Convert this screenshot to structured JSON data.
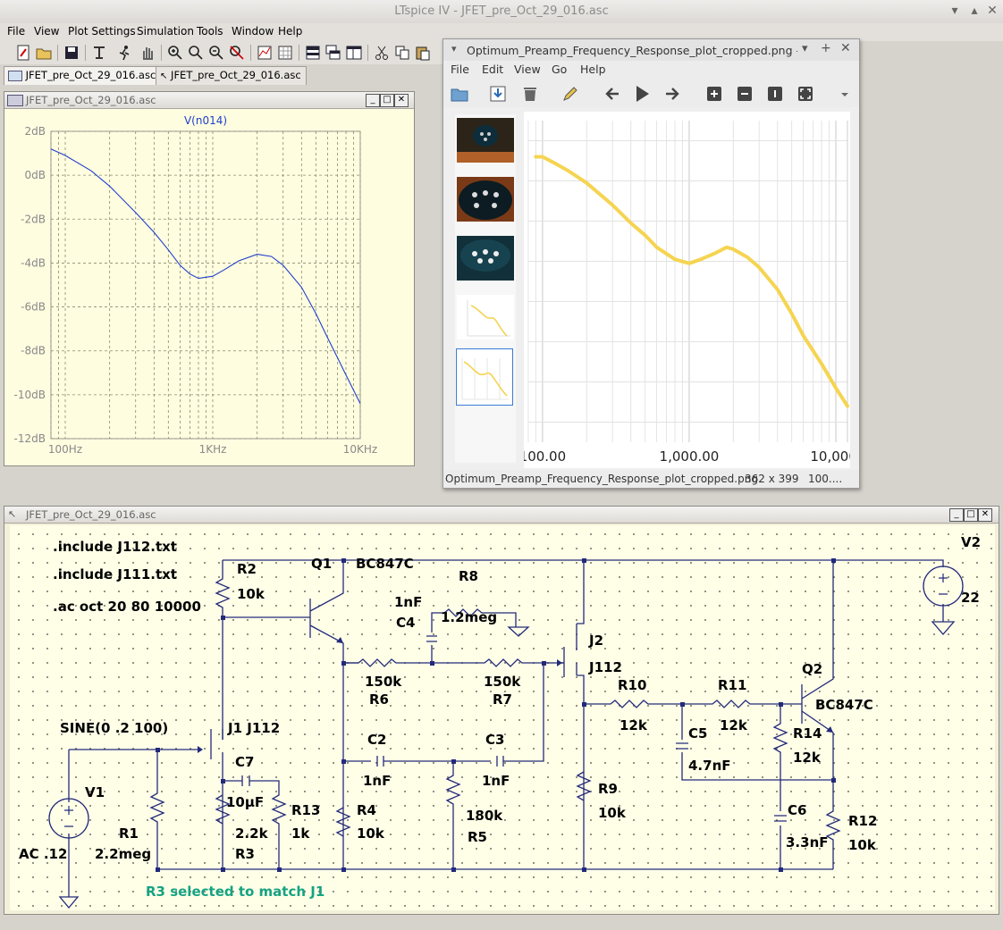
{
  "app": {
    "title": "LTspice IV - JFET_pre_Oct_29_016.asc"
  },
  "menu": [
    "File",
    "View",
    "Plot Settings",
    "Simulation",
    "Tools",
    "Window",
    "Help"
  ],
  "tabs": [
    "JFET_pre_Oct_29_016.asc",
    "JFET_pre_Oct_29_016.asc"
  ],
  "plot_window": {
    "title": "JFET_pre_Oct_29_016.asc",
    "trace_label": "V(n014)",
    "y_ticks": [
      "2dB",
      "0dB",
      "-2dB",
      "-4dB",
      "-6dB",
      "-8dB",
      "-10dB",
      "-12dB"
    ],
    "x_ticks": [
      "100Hz",
      "1KHz",
      "10KHz"
    ]
  },
  "chart_data": [
    {
      "type": "line",
      "title": "V(n014)",
      "x_scale": "log",
      "xlim": [
        80,
        10000
      ],
      "ylim": [
        -12,
        2
      ],
      "grid": true,
      "series": [
        {
          "name": "V(n014)",
          "color": "#1f3fcc",
          "x": [
            80,
            100,
            150,
            200,
            300,
            400,
            500,
            600,
            700,
            800,
            1000,
            1200,
            1500,
            2000,
            2500,
            3000,
            4000,
            5000,
            6000,
            7000,
            8000,
            10000
          ],
          "y": [
            1.2,
            0.9,
            0.2,
            -0.5,
            -1.7,
            -2.6,
            -3.4,
            -4.1,
            -4.5,
            -4.7,
            -4.6,
            -4.3,
            -3.9,
            -3.6,
            -3.7,
            -4.1,
            -5.1,
            -6.3,
            -7.4,
            -8.3,
            -9.1,
            -10.4
          ]
        }
      ]
    },
    {
      "type": "line",
      "x_scale": "log",
      "xlim": [
        80,
        12000
      ],
      "grid": true,
      "x_tick_labels": [
        "100.00",
        "1,000.00",
        "10,000."
      ],
      "series": [
        {
          "color": "#f5d451",
          "x": [
            90,
            100,
            120,
            150,
            200,
            300,
            400,
            500,
            600,
            800,
            1000,
            1200,
            1500,
            1800,
            2000,
            2500,
            3000,
            4000,
            5000,
            6000,
            8000,
            10000,
            12000
          ],
          "y": [
            1.2,
            1.2,
            0.9,
            0.5,
            -0.1,
            -1.2,
            -2.1,
            -2.7,
            -3.3,
            -3.9,
            -4.1,
            -3.9,
            -3.6,
            -3.3,
            -3.4,
            -3.8,
            -4.3,
            -5.4,
            -6.6,
            -7.7,
            -9.1,
            -10.3,
            -11.2
          ]
        }
      ]
    }
  ],
  "viewer": {
    "title": "Optimum_Preamp_Frequency_Response_plot_cropped.png - I",
    "menu": [
      "File",
      "Edit",
      "View",
      "Go",
      "Help"
    ],
    "status_file": "Optimum_Preamp_Frequency_Response_plot_cropped.png",
    "status_dims": "362 x 399",
    "status_zoom": "100...."
  },
  "schematic": {
    "title": "JFET_pre_Oct_29_016.asc",
    "directives": [
      ".include J112.txt",
      ".include J111.txt",
      ".ac oct 20 80 10000"
    ],
    "source_label": "SINE(0 .2 100)",
    "note": "R3 selected to match J1",
    "labels": {
      "V1": "V1",
      "ac": "AC .12",
      "R1": "R1",
      "R1v": "2.2meg",
      "J1": "J1  J112",
      "C7": "C7",
      "C7v": "10µF",
      "R3v": "2.2k",
      "R3": "R3",
      "R13": "R13",
      "R13v": "1k",
      "R2": "R2",
      "R2v": "10k",
      "Q1": "Q1",
      "Q1m": "BC847C",
      "C4v": "1nF",
      "C4": "C4",
      "R8": "R8",
      "R8v": "1.2meg",
      "R6v": "150k",
      "R6": "R6",
      "R7v": "150k",
      "R7": "R7",
      "C2": "C2",
      "C2v": "1nF",
      "C3": "C3",
      "C3v": "1nF",
      "R4": "R4",
      "R4v": "10k",
      "R5v": "180k",
      "R5": "R5",
      "J2": "J2",
      "J2m": "J112",
      "R9": "R9",
      "R9v": "10k",
      "R10": "R10",
      "R10v": "12k",
      "R11": "R11",
      "R11v": "12k",
      "C5": "C5",
      "C5v": "4.7nF",
      "Q2": "Q2",
      "Q2m": "BC847C",
      "R14": "R14",
      "R14v": "12k",
      "C6": "C6",
      "C6v": "3.3nF",
      "R12": "R12",
      "R12v": "10k",
      "V2": "V2",
      "V2v": "22"
    }
  }
}
